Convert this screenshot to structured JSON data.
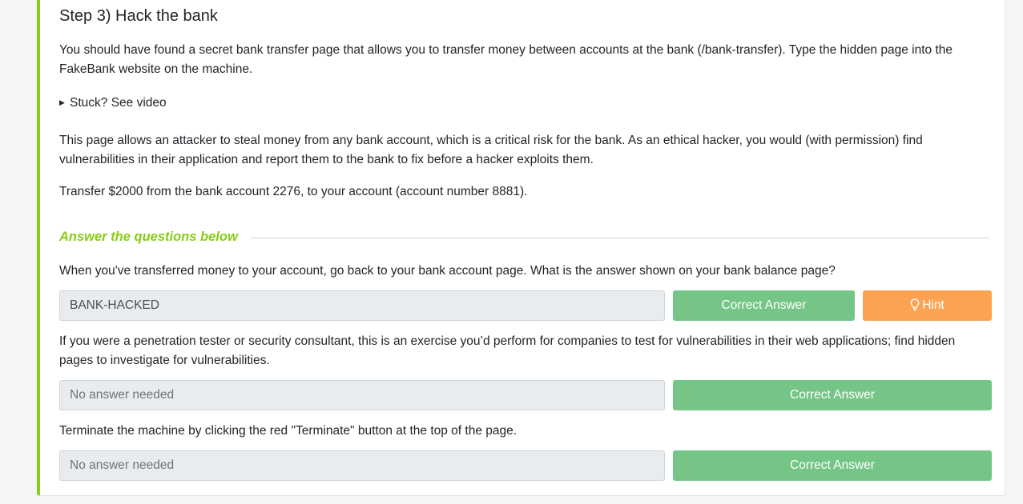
{
  "task": {
    "title": "Step 3) Hack the bank",
    "intro": "You should have found a secret bank transfer page that allows you to transfer money between accounts at the bank (/bank-transfer). Type the hidden page into the FakeBank website on the machine.",
    "stuck_label": "Stuck? See video",
    "paragraph2": "This page allows an attacker to steal money from any bank account, which is a critical risk for the bank. As an ethical hacker, you would (with permission) find vulnerabilities in their application and report them to the bank to fix before a hacker exploits them.",
    "paragraph3": "Transfer $2000 from the bank account 2276, to your account (account number 8881).",
    "answer_header": "Answer the questions below"
  },
  "questions": [
    {
      "text": "When you've transferred money to your account, go back to your bank account page. What is the answer shown on your bank balance page?",
      "answer": "BANK-HACKED",
      "button": "Correct Answer",
      "hint": "Hint"
    },
    {
      "text": "If you were a penetration tester or security consultant, this is an exercise you’d perform for companies to test for vulnerabilities in their web applications; find hidden pages to investigate for vulnerabilities.",
      "answer": "No answer needed",
      "button": "Correct Answer"
    },
    {
      "text": "Terminate the machine by clicking the red \"Terminate\" button at the top of the page.",
      "answer": "No answer needed",
      "button": "Correct Answer"
    }
  ],
  "colors": {
    "accent": "#88cc14",
    "correct_button": "#75c587",
    "hint_button": "#fba353"
  }
}
